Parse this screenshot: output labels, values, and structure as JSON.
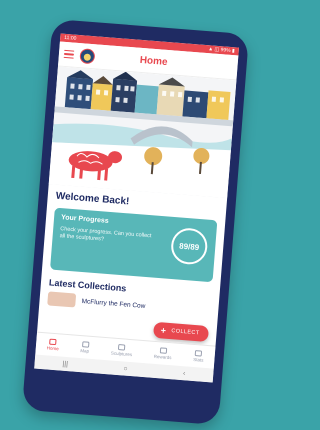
{
  "status_bar": {
    "time": "11:00",
    "icons_text": "▲ ◫ 99% ▮"
  },
  "app_bar": {
    "title": "Home"
  },
  "welcome": {
    "title": "Welcome Back!"
  },
  "progress": {
    "title": "Your Progress",
    "text": "Check your progress. Can you collect all the sculptures?",
    "count": "89/89",
    "fraction": 1.0
  },
  "latest": {
    "title": "Latest Collections",
    "items": [
      {
        "name": "McFlurry the Fen Cow"
      }
    ]
  },
  "fab": {
    "label": "COLLECT"
  },
  "bottom_nav": {
    "items": [
      {
        "label": "Home",
        "icon": "home-icon"
      },
      {
        "label": "Map",
        "icon": "map-pin-icon"
      },
      {
        "label": "Sculptures",
        "icon": "sculpture-icon"
      },
      {
        "label": "Rewards",
        "icon": "trophy-icon"
      },
      {
        "label": "Stats",
        "icon": "stats-icon"
      }
    ]
  },
  "system_nav": {
    "recents_glyph": "|||",
    "home_glyph": "○",
    "back_glyph": "‹"
  },
  "colors": {
    "background": "#3aa3a8",
    "phone_body": "#1f2b63",
    "accent": "#e8484f",
    "card": "#58b7b8",
    "text_dark": "#1f2b63"
  }
}
